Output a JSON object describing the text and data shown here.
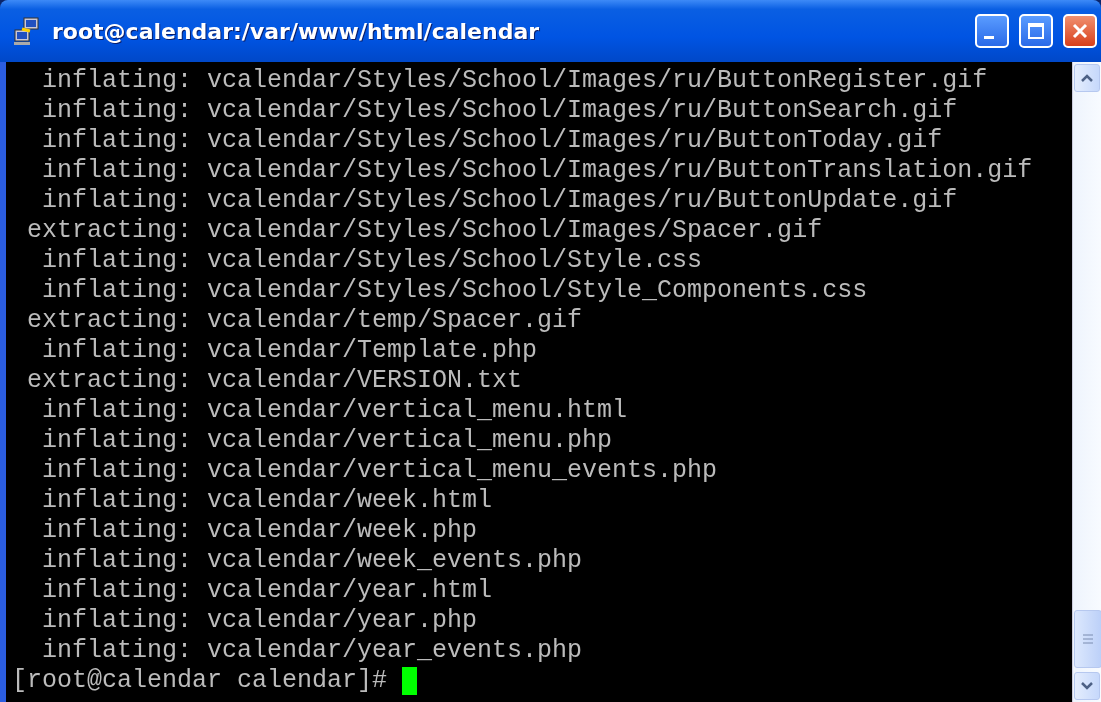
{
  "window": {
    "title": "root@calendar:/var/www/html/calendar"
  },
  "terminal": {
    "lines": [
      "  inflating: vcalendar/Styles/School/Images/ru/ButtonRegister.gif",
      "  inflating: vcalendar/Styles/School/Images/ru/ButtonSearch.gif",
      "  inflating: vcalendar/Styles/School/Images/ru/ButtonToday.gif",
      "  inflating: vcalendar/Styles/School/Images/ru/ButtonTranslation.gif",
      "  inflating: vcalendar/Styles/School/Images/ru/ButtonUpdate.gif",
      " extracting: vcalendar/Styles/School/Images/Spacer.gif",
      "  inflating: vcalendar/Styles/School/Style.css",
      "  inflating: vcalendar/Styles/School/Style_Components.css",
      " extracting: vcalendar/temp/Spacer.gif",
      "  inflating: vcalendar/Template.php",
      " extracting: vcalendar/VERSION.txt",
      "  inflating: vcalendar/vertical_menu.html",
      "  inflating: vcalendar/vertical_menu.php",
      "  inflating: vcalendar/vertical_menu_events.php",
      "  inflating: vcalendar/week.html",
      "  inflating: vcalendar/week.php",
      "  inflating: vcalendar/week_events.php",
      "  inflating: vcalendar/year.html",
      "  inflating: vcalendar/year.php",
      "  inflating: vcalendar/year_events.php"
    ],
    "prompt": "[root@calendar calendar]# "
  }
}
